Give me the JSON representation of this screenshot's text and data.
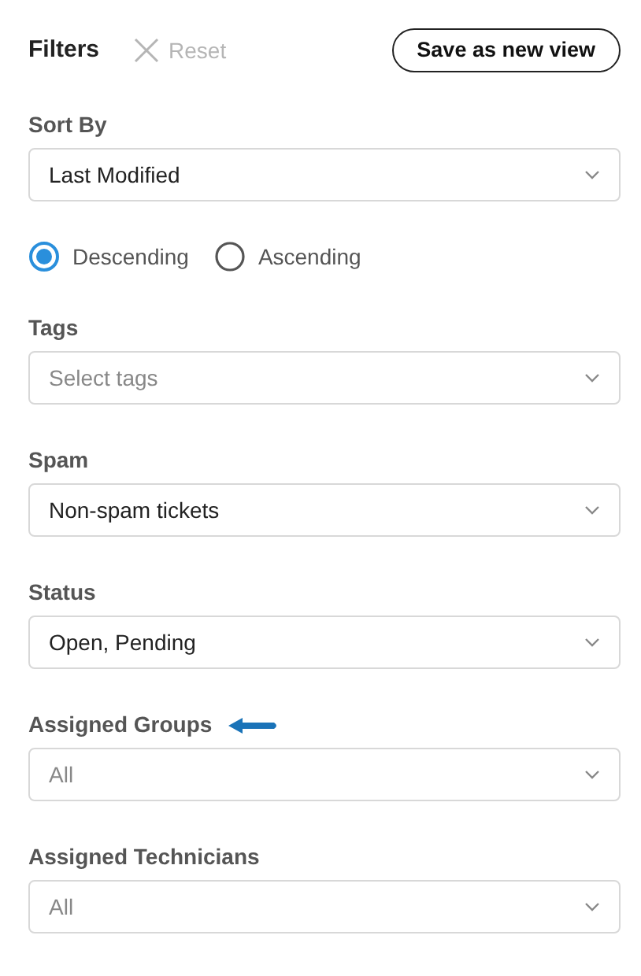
{
  "header": {
    "title": "Filters",
    "reset": {
      "label": "Reset",
      "disabled": true
    },
    "save_button": "Save as new view"
  },
  "filters": [
    {
      "kind": "select",
      "label": "Sort By",
      "value": "Last Modified",
      "pointer_arrow": false
    },
    {
      "kind": "radios",
      "options": [
        {
          "label": "Descending",
          "selected": true
        },
        {
          "label": "Ascending",
          "selected": false
        }
      ]
    },
    {
      "kind": "select",
      "label": "Tags",
      "placeholder": "Select tags",
      "pointer_arrow": false
    },
    {
      "kind": "select",
      "label": "Spam",
      "value": "Non-spam tickets",
      "pointer_arrow": false
    },
    {
      "kind": "select",
      "label": "Status",
      "value": "Open, Pending",
      "pointer_arrow": false
    },
    {
      "kind": "select",
      "label": "Assigned Groups",
      "placeholder": "All",
      "pointer_arrow": true
    },
    {
      "kind": "select",
      "label": "Assigned Technicians",
      "placeholder": "All",
      "pointer_arrow": false
    }
  ]
}
